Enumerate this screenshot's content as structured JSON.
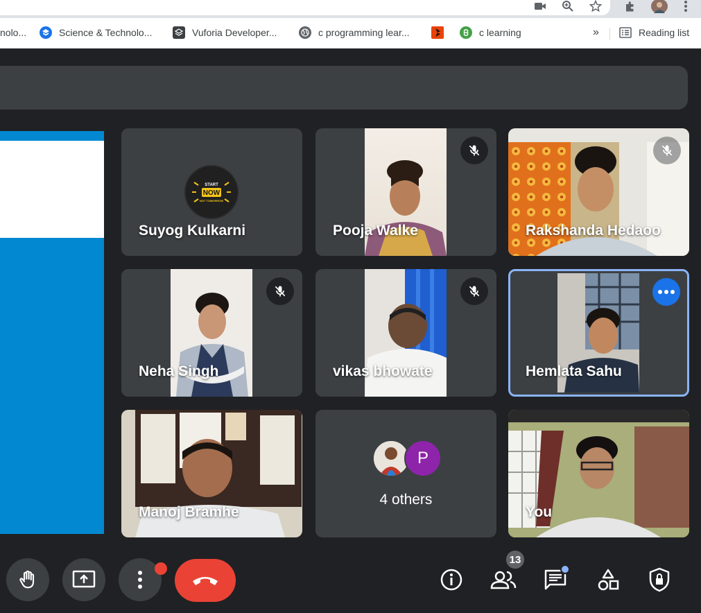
{
  "bookmarks": [
    {
      "label": "nolo...",
      "icon": "bookmark-icon",
      "color": "#5f6368"
    },
    {
      "label": "Science & Technolo...",
      "icon": "science-globe-icon",
      "color": "#1a73e8"
    },
    {
      "label": "Vuforia Developer...",
      "icon": "vuforia-icon",
      "color": "#3c4043"
    },
    {
      "label": "c programming lear...",
      "icon": "globe-icon",
      "color": "#5f6368"
    },
    {
      "label": "",
      "icon": "orange-app-icon",
      "color": "#e8430a"
    },
    {
      "label": "c learning",
      "icon": "c-learning-icon",
      "color": "#43a047"
    }
  ],
  "bookmarks_more": "»",
  "reading_list": "Reading list",
  "participants": [
    {
      "name": "Suyog Kulkarni",
      "avatar_text": "START NOW NOT TOMORROW",
      "muted": false
    },
    {
      "name": "Pooja Walke",
      "muted": true
    },
    {
      "name": "Rakshanda Hedaoo",
      "muted": true
    },
    {
      "name": "Neha Singh",
      "muted": true
    },
    {
      "name": "vikas bhowate",
      "muted": true
    },
    {
      "name": "Hemlata Sahu",
      "muted": false,
      "active": true
    },
    {
      "name": "Manoj Bramhe",
      "muted": false
    },
    {
      "name": "You",
      "muted": false
    }
  ],
  "others": {
    "label": "4 others",
    "avatar_letter": "P",
    "avatar_color": "#8e24aa"
  },
  "people_count": "13",
  "colors": {
    "end_call": "#ea4335",
    "active_border": "#8ab4f8",
    "badge_dot": "#ea4335",
    "chat_dot": "#8ab4f8",
    "more_button": "#1a73e8"
  }
}
